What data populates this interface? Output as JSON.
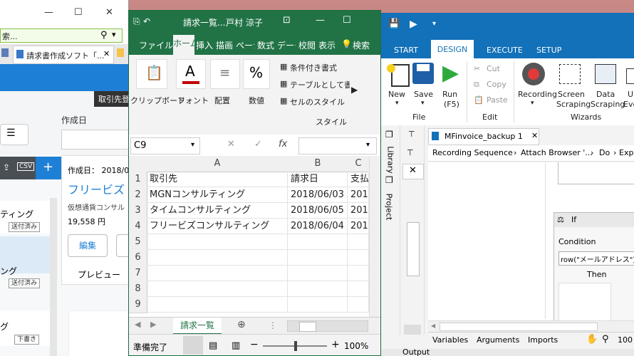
{
  "browser": {
    "address_suffix": "索...",
    "tab_label": "請求書作成ソフト「...",
    "register_button": "取引先登",
    "created_label": "作成日",
    "detail_created": "作成日： 2018/0",
    "detail_company": "フリービズ",
    "detail_sub": "仮想通貨コンサル",
    "detail_amount": "19,558 円",
    "edit_button": "編集",
    "preview_tab": "プレビュー",
    "list": [
      {
        "name": "ティング",
        "status": "送付済み"
      },
      {
        "name": "ング",
        "status": "送付済み"
      },
      {
        "name": "グ",
        "status": "下書き"
      }
    ]
  },
  "excel": {
    "title": "請求一覧...",
    "user": "戸村 涼子",
    "tabs": [
      "ファイル",
      "ホーム",
      "挿入",
      "描画",
      "ページ",
      "数式",
      "データ",
      "校閲",
      "表示",
      "検索"
    ],
    "ribbon": {
      "clipboard": "クリップボード",
      "font": "フォント",
      "align": "配置",
      "number": "数値",
      "cond_format": "条件付き書式",
      "table_format": "テーブルとして書式",
      "cell_style": "セルのスタイル",
      "style_group": "スタイル"
    },
    "cell_ref": "C9",
    "fx": "fx",
    "columns": [
      "A",
      "B",
      "C"
    ],
    "rows": [
      {
        "num": "1",
        "a": "取引先",
        "b": "請求日",
        "c": "支払"
      },
      {
        "num": "2",
        "a": "MGNコンサルティング",
        "b": "2018/06/03",
        "c": "2018"
      },
      {
        "num": "3",
        "a": "タイムコンサルティング",
        "b": "2018/06/05",
        "c": "2018"
      },
      {
        "num": "4",
        "a": "フリービズコンサルティング",
        "b": "2018/06/04",
        "c": "2018"
      },
      {
        "num": "5",
        "a": "",
        "b": "",
        "c": ""
      },
      {
        "num": "6",
        "a": "",
        "b": "",
        "c": ""
      },
      {
        "num": "7",
        "a": "",
        "b": "",
        "c": ""
      },
      {
        "num": "8",
        "a": "",
        "b": "",
        "c": ""
      },
      {
        "num": "9",
        "a": "",
        "b": "",
        "c": ""
      }
    ],
    "sheet_tab": "請求一覧",
    "status": "準備完了",
    "zoom": "100%"
  },
  "uipath": {
    "tabs": [
      "START",
      "DESIGN",
      "EXECUTE",
      "SETUP"
    ],
    "new": "New",
    "save": "Save",
    "run": "Run",
    "run_key": "(F5)",
    "cut": "Cut",
    "copy": "Copy",
    "paste": "Paste",
    "recording": "Recording",
    "screen_scraping": "Screen Scraping",
    "screen_scraping_l1": "Screen",
    "screen_scraping_l2": "Scraping",
    "data_scraping_l1": "Data",
    "data_scraping_l2": "Scraping",
    "user_events_l1": "U",
    "user_events_l2": "Eve",
    "group_file": "File",
    "group_edit": "Edit",
    "group_wizards": "Wizards",
    "side_library": "Library",
    "side_project": "Project",
    "doc_tab": "MFinvoice_backup 1",
    "breadcrumb": [
      "Recording Sequence",
      "Attach Browser '...",
      "Do",
      "Expa"
    ],
    "if_title": "If",
    "condition_label": "Condition",
    "condition_value": "row(\"メールアドレス\").T",
    "then_label": "Then",
    "bottom_tabs": [
      "Variables",
      "Arguments",
      "Imports"
    ],
    "zoom": "100",
    "output": "Output"
  }
}
